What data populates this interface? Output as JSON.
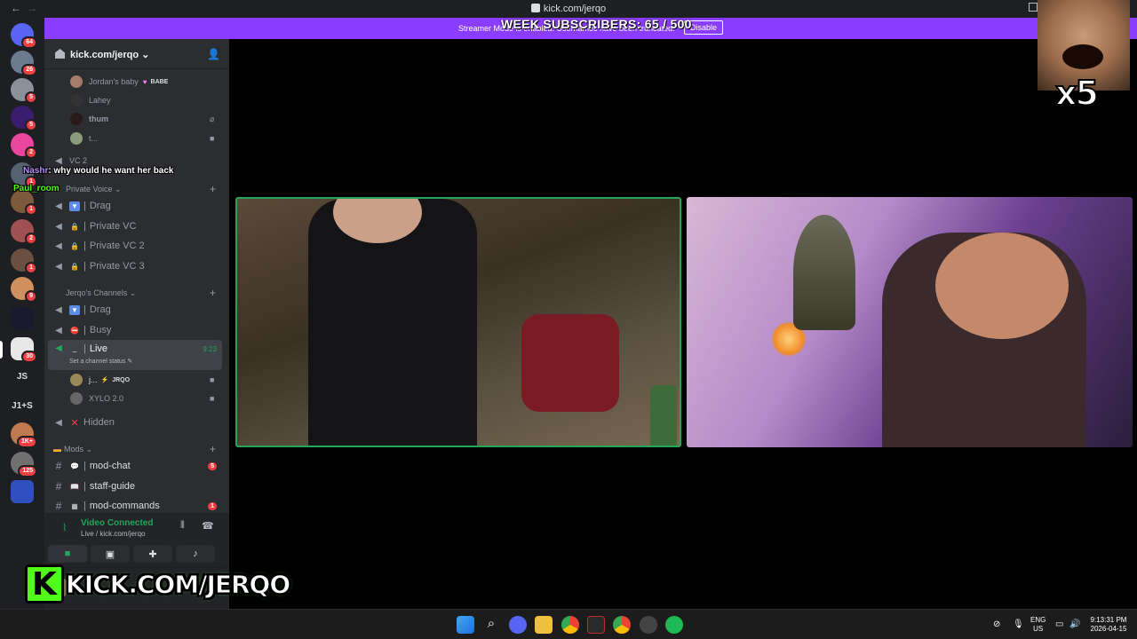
{
  "titlebar": {
    "url": "kick.com/jerqo",
    "back": "←",
    "forward": "→"
  },
  "banner": {
    "message": "Streamer Mode is enabled. Usernames have been truncated.",
    "disable_label": "Disable",
    "subs_overlay": "WEEK SUBSCRIBERS: 65 / 500"
  },
  "rail": {
    "badges": [
      "64",
      "26",
      "5",
      "5",
      "2",
      "1",
      "1",
      "2",
      "1",
      "9",
      "30",
      "1K+",
      "125"
    ],
    "text_servers": [
      "JS",
      "J1+S"
    ]
  },
  "server": {
    "name": "kick.com/jerqo"
  },
  "top_voice_users": [
    {
      "name": "Jordan's baby",
      "tag": "BABE"
    },
    {
      "name": "Lahey"
    },
    {
      "name": "thum"
    },
    {
      "name": "t..."
    }
  ],
  "vc2": "VC 2",
  "private_cat": "Private Voice",
  "private_channels": [
    "Drag",
    "Private VC",
    "Private VC 2",
    "Private VC 3"
  ],
  "jerqo_cat": "Jerqo's Channels",
  "jerqo_channels": {
    "drag": "Drag",
    "busy": "Busy",
    "live": "Live",
    "live_time": "9:23",
    "live_status": "Set a channel status",
    "live_users": [
      {
        "name": "j...",
        "tag": "JRQO"
      },
      {
        "name": "XYLO 2.0"
      }
    ],
    "hidden": "Hidden"
  },
  "mods_cat": "Mods",
  "mod_channels": [
    {
      "name": "mod-chat",
      "count": "5"
    },
    {
      "name": "staff-guide"
    },
    {
      "name": "mod-commands",
      "count": "1"
    }
  ],
  "voice_panel": {
    "status": "Video Connected",
    "location": "Live / kick.com/jerqo"
  },
  "chat": [
    {
      "user": "Nashr",
      "text": ": why would he want her back",
      "user_color": "#b88cff"
    },
    {
      "user": "Paul_room",
      "text": "",
      "user_color": "#53fc18"
    }
  ],
  "brand_text": "KICK.COM/JERQO",
  "meme_multiplier": "x5",
  "taskbar": {
    "lang": "ENG",
    "region": "US",
    "time": "9:13:31 PM",
    "date": "2026-04-15"
  },
  "colors": {
    "kick_green": "#53fc18",
    "discord_green": "#23a55a",
    "banner_purple": "#8b3dff"
  }
}
